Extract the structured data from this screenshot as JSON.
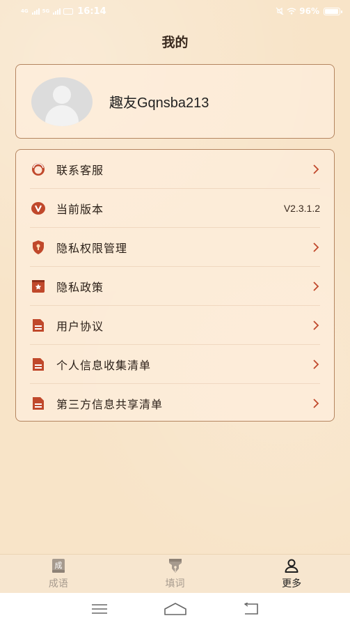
{
  "status_bar": {
    "time": "16:14",
    "signal1_tag": "4G",
    "signal2_tag": "5G",
    "battery_percent": "96%"
  },
  "page": {
    "title": "我的"
  },
  "profile": {
    "username": "趣友Gqnsba213"
  },
  "menu": {
    "items": [
      {
        "label": "联系客服",
        "icon": "customer-service-icon",
        "value": ""
      },
      {
        "label": "当前版本",
        "icon": "version-icon",
        "value": "V2.3.1.2"
      },
      {
        "label": "隐私权限管理",
        "icon": "shield-lock-icon",
        "value": ""
      },
      {
        "label": "隐私政策",
        "icon": "bookmark-star-icon",
        "value": ""
      },
      {
        "label": "用户协议",
        "icon": "document-icon",
        "value": ""
      },
      {
        "label": "个人信息收集清单",
        "icon": "document-icon",
        "value": ""
      },
      {
        "label": "第三方信息共享清单",
        "icon": "document-icon",
        "value": ""
      }
    ]
  },
  "tabs": [
    {
      "label": "成语",
      "icon": "chengyu-book-icon",
      "icon_text": "成",
      "active": false
    },
    {
      "label": "填词",
      "icon": "pen-nib-icon",
      "active": false
    },
    {
      "label": "更多",
      "icon": "person-icon",
      "active": true
    }
  ],
  "colors": {
    "accent": "#c0482b",
    "background": "#f8e4c8",
    "card_border": "#b48560"
  }
}
